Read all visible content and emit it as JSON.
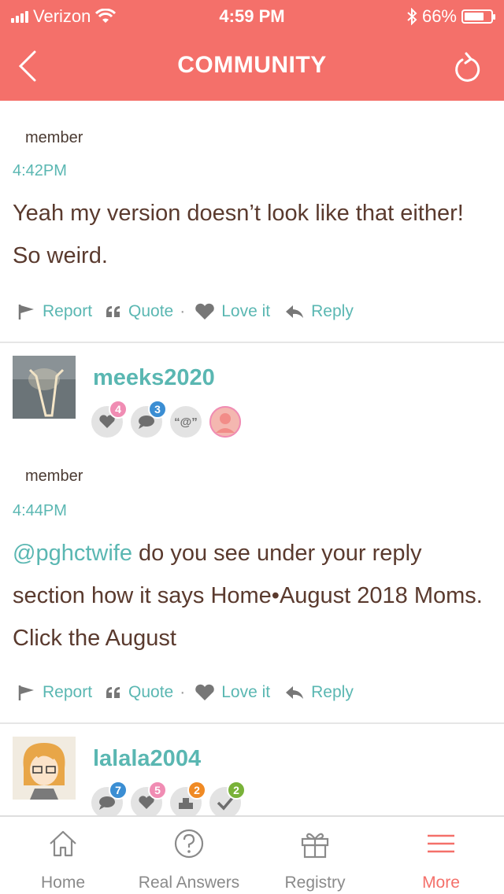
{
  "status_bar": {
    "carrier": "Verizon",
    "time": "4:59 PM",
    "battery": "66%"
  },
  "header": {
    "title": "COMMUNITY"
  },
  "posts": [
    {
      "member_label": "member",
      "time": "4:42PM",
      "body": "Yeah my version doesn’t look like that either! So weird.",
      "actions": {
        "report": "Report",
        "quote": "Quote",
        "love": "Love it",
        "reply": "Reply"
      }
    },
    {
      "username": "meeks2020",
      "badges": [
        {
          "icon": "heart-icon",
          "count": "4",
          "color": "#f08cb3"
        },
        {
          "icon": "comment-icon",
          "count": "3",
          "color": "#3b8ed3"
        },
        {
          "icon": "mention-icon",
          "label": "“@”"
        },
        {
          "icon": "profile-icon"
        }
      ],
      "member_label": "member",
      "time": "4:44PM",
      "mention": "@pghctwife",
      "body": " do you see under your reply section how it says Home•August 2018 Moms.  Click the August",
      "actions": {
        "report": "Report",
        "quote": "Quote",
        "love": "Love it",
        "reply": "Reply"
      }
    },
    {
      "username": "lalala2004",
      "badges": [
        {
          "icon": "comment-icon",
          "count": "7",
          "color": "#3b8ed3"
        },
        {
          "icon": "heart-icon",
          "count": "5",
          "color": "#f08cb3"
        },
        {
          "icon": "cake-icon",
          "count": "2",
          "color": "#f08a24"
        },
        {
          "icon": "check-icon",
          "count": "2",
          "color": "#79b239"
        }
      ]
    }
  ],
  "tabbar": [
    {
      "label": "Home",
      "icon": "home-icon"
    },
    {
      "label": "Real Answers",
      "icon": "question-icon"
    },
    {
      "label": "Registry",
      "icon": "gift-icon"
    },
    {
      "label": "More",
      "icon": "menu-icon",
      "active": true
    }
  ],
  "colors": {
    "accent": "#f4706a",
    "link": "#5ab7b2",
    "text": "#5a3a2e"
  }
}
